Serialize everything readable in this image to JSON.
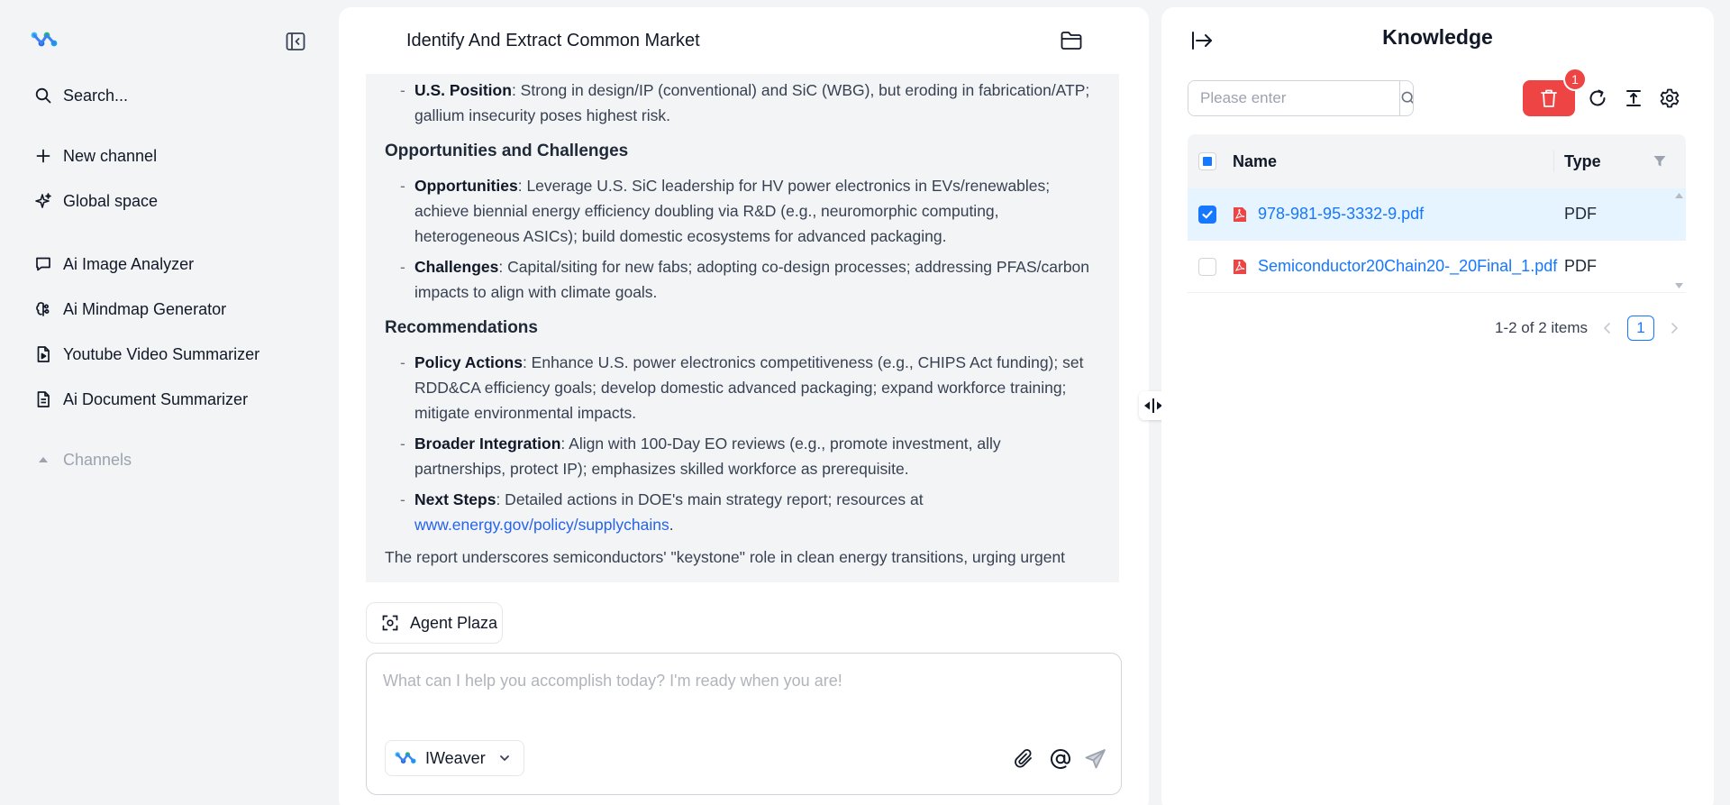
{
  "sidebar": {
    "search_label": "Search...",
    "new_channel": "New channel",
    "global_space": "Global space",
    "tools": [
      {
        "label": "Ai Image Analyzer",
        "icon": "chat-bubble-icon"
      },
      {
        "label": "Ai Mindmap Generator",
        "icon": "brain-icon"
      },
      {
        "label": "Youtube Video Summarizer",
        "icon": "video-file-icon"
      },
      {
        "label": "Ai Document Summarizer",
        "icon": "document-icon"
      }
    ],
    "channels_label": "Channels"
  },
  "chat": {
    "title": "Identify And Extract Common Market",
    "message": {
      "item_position_label": "U.S. Position",
      "item_position_text": ": Strong in design/IP (conventional) and SiC (WBG), but eroding in fabrication/ATP; gallium insecurity poses highest risk.",
      "section_opportunities": "Opportunities and Challenges",
      "item_opportunities_label": "Opportunities",
      "item_opportunities_text": ": Leverage U.S. SiC leadership for HV power electronics in EVs/renewables; achieve biennial energy efficiency doubling via R&D (e.g., neuromorphic computing, heterogeneous ASICs); build domestic ecosystems for advanced packaging.",
      "item_challenges_label": "Challenges",
      "item_challenges_text": ": Capital/siting for new fabs; adopting co-design processes; addressing PFAS/carbon impacts to align with climate goals.",
      "section_recommendations": "Recommendations",
      "item_policy_label": "Policy Actions",
      "item_policy_text": ": Enhance U.S. power electronics competitiveness (e.g., CHIPS Act funding); set RDD&CA efficiency goals; develop domestic advanced packaging; expand workforce training; mitigate environmental impacts.",
      "item_broader_label": "Broader Integration",
      "item_broader_text": ": Align with 100-Day EO reviews (e.g., promote investment, ally partnerships, protect IP); emphasizes skilled workforce as prerequisite.",
      "item_next_label": "Next Steps",
      "item_next_text": ": Detailed actions in DOE's main strategy report; resources at",
      "item_next_link": "www.energy.gov/policy/supplychains",
      "item_next_end": ".",
      "closing_text": "The report underscores semiconductors' \"keystone\" role in clean energy transitions, urging urgent"
    },
    "agent_plaza": "Agent Plaza",
    "composer_placeholder": "What can I help you accomplish today? I'm ready when you are!",
    "model_name": "IWeaver"
  },
  "knowledge": {
    "title": "Knowledge",
    "search_placeholder": "Please enter",
    "delete_badge": "1",
    "columns": {
      "name": "Name",
      "type": "Type"
    },
    "files": [
      {
        "name": "978-981-95-3332-9.pdf",
        "type": "PDF",
        "selected": true
      },
      {
        "name": "Semiconductor20Chain20-_20Final_1.pdf",
        "type": "PDF",
        "selected": false
      }
    ],
    "pagination": {
      "summary": "1-2 of 2 items",
      "current_page": "1"
    }
  },
  "colors": {
    "accent": "#1677ff",
    "danger": "#ef4444",
    "selected_row": "#e6f4ff",
    "background": "#f3f4f6"
  }
}
